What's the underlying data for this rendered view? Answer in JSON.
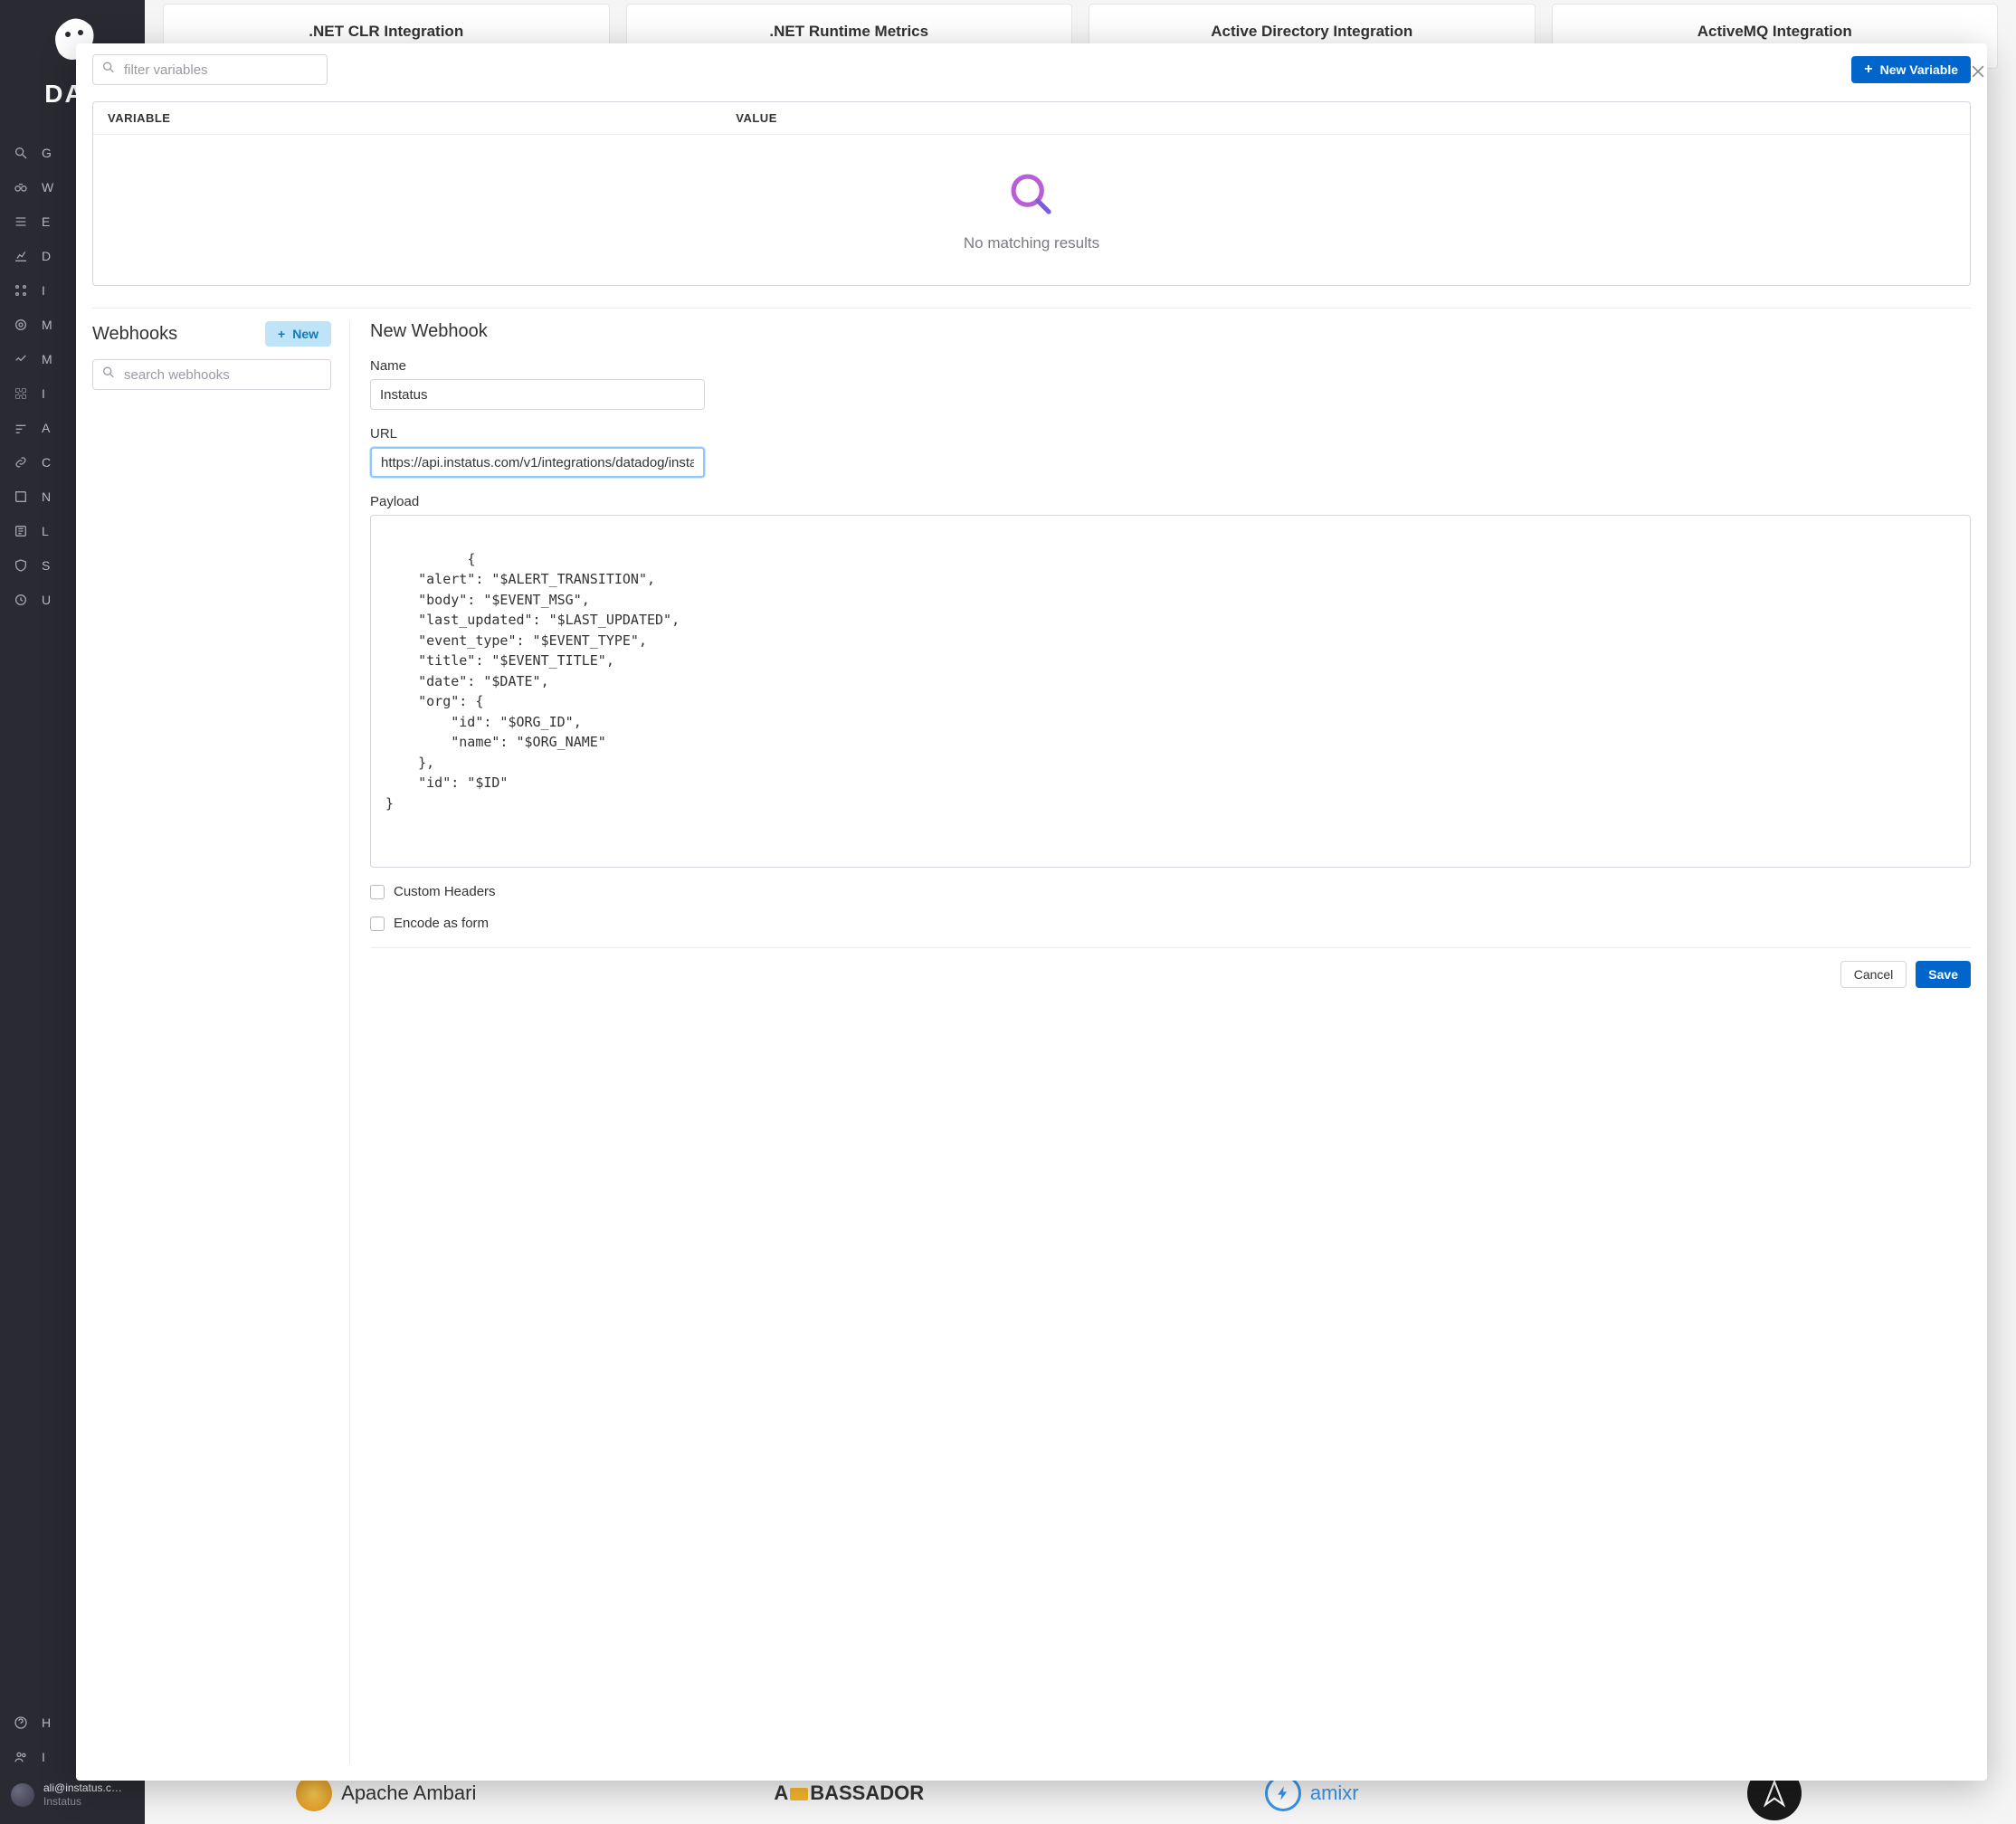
{
  "brand": "DAT",
  "sidebar": {
    "items": [
      {
        "label": "G"
      },
      {
        "label": "W"
      },
      {
        "label": "E"
      },
      {
        "label": "D"
      },
      {
        "label": "I"
      },
      {
        "label": "M"
      },
      {
        "label": "M"
      },
      {
        "label": "I"
      },
      {
        "label": "A"
      },
      {
        "label": "C"
      },
      {
        "label": "N"
      },
      {
        "label": "L"
      },
      {
        "label": "S"
      },
      {
        "label": "U"
      }
    ],
    "bottom": [
      {
        "label": "H"
      },
      {
        "label": "I"
      }
    ]
  },
  "user": {
    "email": "ali@instatus.c…",
    "org": "Instatus"
  },
  "bg_tiles": [
    ".NET CLR Integration",
    ".NET Runtime Metrics",
    "Active Directory Integration",
    "ActiveMQ Integration"
  ],
  "bottom_cards": [
    {
      "label": "Apache Ambari"
    },
    {
      "label": "BASSADOR",
      "prefix": "A"
    },
    {
      "label": "amixr"
    },
    {
      "label": ""
    }
  ],
  "variables": {
    "filter_placeholder": "filter variables",
    "new_btn": "New Variable",
    "col1": "VARIABLE",
    "col2": "VALUE",
    "empty": "No matching results"
  },
  "webhooks": {
    "title": "Webhooks",
    "new_btn": "New",
    "search_placeholder": "search webhooks"
  },
  "form": {
    "title": "New Webhook",
    "name_label": "Name",
    "name_value": "Instatus",
    "url_label": "URL",
    "url_value": "https://api.instatus.com/v1/integrations/datadog/insta",
    "payload_label": "Payload",
    "payload_text": "{\n    \"alert\": \"$ALERT_TRANSITION\",\n    \"body\": \"$EVENT_MSG\",\n    \"last_updated\": \"$LAST_UPDATED\",\n    \"event_type\": \"$EVENT_TYPE\",\n    \"title\": \"$EVENT_TITLE\",\n    \"date\": \"$DATE\",\n    \"org\": {\n        \"id\": \"$ORG_ID\",\n        \"name\": \"$ORG_NAME\"\n    },\n    \"id\": \"$ID\"\n}",
    "custom_headers": "Custom Headers",
    "encode_form": "Encode as form",
    "cancel": "Cancel",
    "save": "Save"
  }
}
